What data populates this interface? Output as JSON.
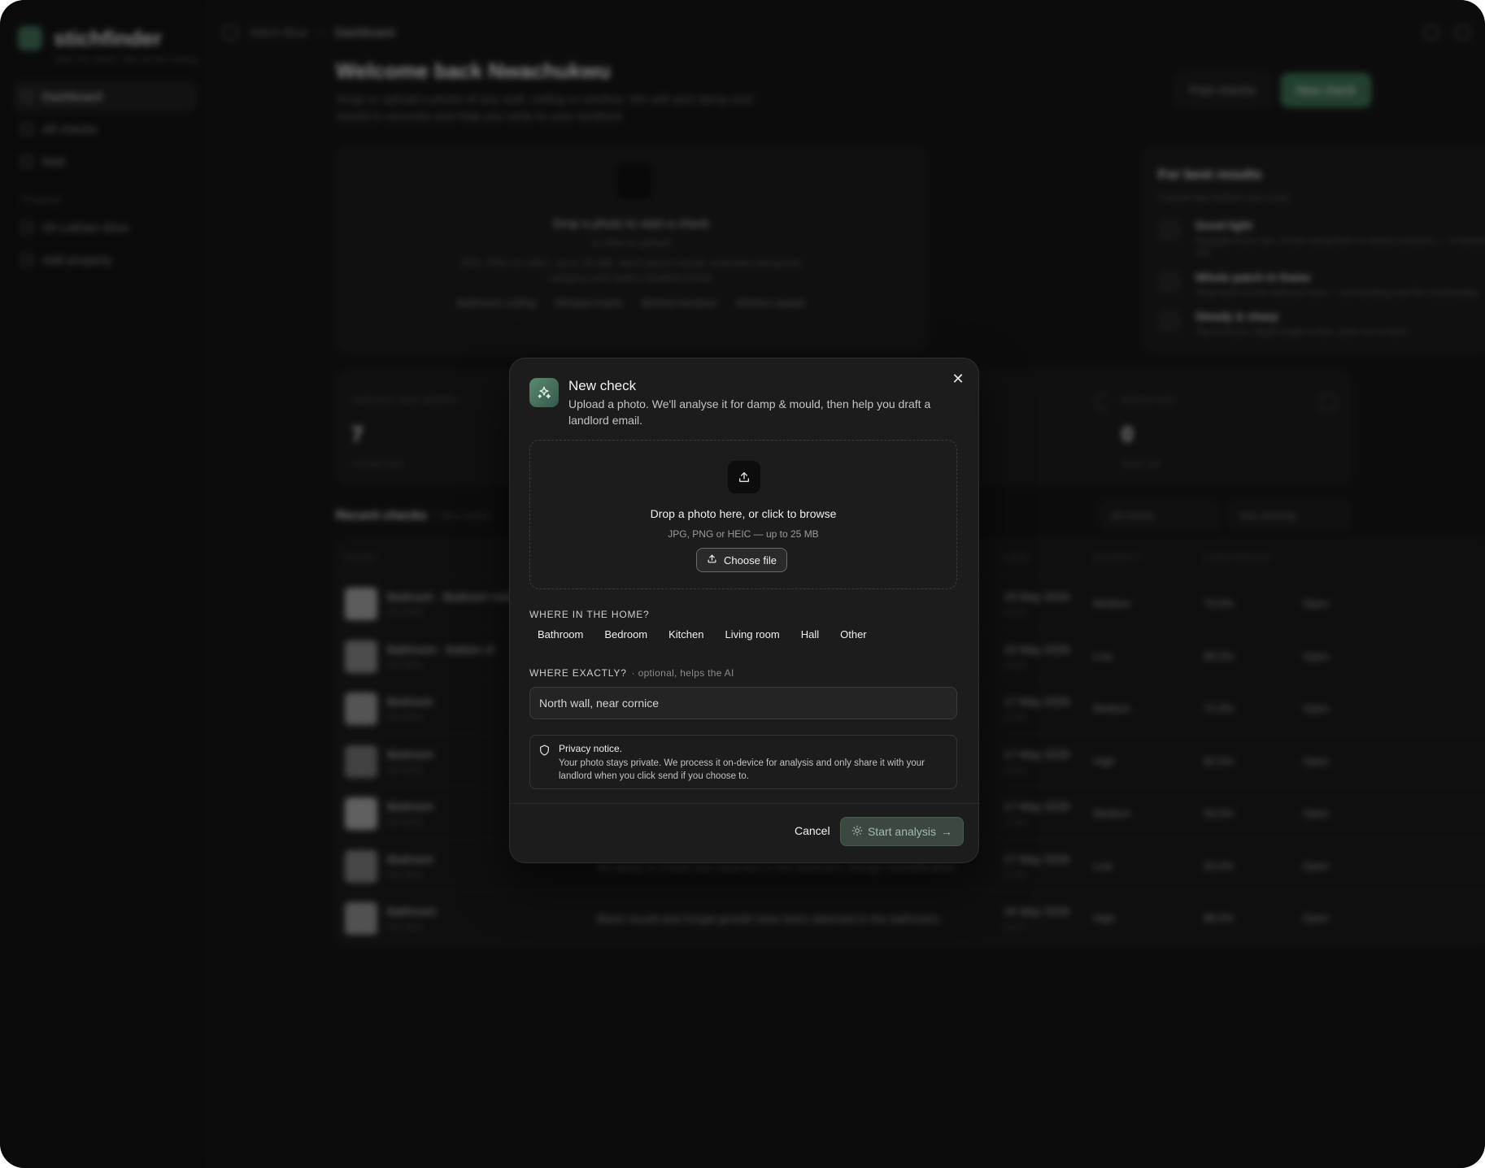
{
  "app": {
    "brand_name": "stichfinder",
    "brand_tagline": "Take the photo. We do the writing.",
    "nav": [
      {
        "label": "Dashboard",
        "active": true
      },
      {
        "label": "All checks",
        "active": false
      },
      {
        "label": "Mail",
        "active": false
      }
    ],
    "nav_section_label": "Property",
    "property_items": [
      {
        "label": "29 Lothian drive"
      },
      {
        "label": "Add property"
      }
    ]
  },
  "topbar": {
    "breadcrumb_root": "Stitch Blue",
    "breadcrumb_sep": "›",
    "breadcrumb_current": "Dashboard"
  },
  "header": {
    "welcome": "Welcome back Nwachukwu",
    "subtitle": "Snap or upload a photo of any wall, ceiling or window. We will spot damp and mould in seconds and help you write to your landlord.",
    "past_checks_label": "Past checks",
    "new_check_label": "New check"
  },
  "drop_card": {
    "title": "Drop a photo to start a check",
    "subtitle": "or click to upload",
    "desc": "JPG, PNG or HEIC, up to 25 MB. We'll detect mould, estimate dampness category and draft a landlord email.",
    "chips": [
      "Bathroom ceiling",
      "Window frame",
      "Behind furniture",
      "Kitchen splash"
    ]
  },
  "tips": {
    "title": "For best results",
    "subtitle": "3 quick tips before you snap",
    "items": [
      {
        "h": "Good light",
        "b": "Daylight if you can. Avoid using flash on damp surfaces — it washes them out."
      },
      {
        "h": "Whole patch in frame",
        "b": "Step back so the affected area + surrounding wall fits comfortably."
      },
      {
        "h": "Steady & sharp",
        "b": "Tap to focus. Slight angle is fine, steer on to level."
      }
    ]
  },
  "stats": [
    {
      "label": "CHECKS THIS MONTH",
      "value": "7",
      "sub": "+2 from last"
    },
    {
      "label": "RESOLVED",
      "value": "0",
      "sub": "None yet"
    }
  ],
  "recent": {
    "title": "Recent checks",
    "count": "7 this month",
    "filter_rooms": "All rooms",
    "filter_severity": "Any severity",
    "columns": [
      "ROOM",
      "DATE",
      "SEVERITY",
      "CONFIDENCE"
    ],
    "rows": [
      {
        "room": "Bedroom · Bedroom wall",
        "id": "SH-2480",
        "summary": "",
        "date": "18 May 2026",
        "time": "20:14",
        "sev": "Medium",
        "conf": "73.0%",
        "open": "Open"
      },
      {
        "room": "Bathroom · bottom of",
        "id": "SH-2481",
        "summary": "",
        "date": "18 May 2026",
        "time": "19:02",
        "sev": "Low",
        "conf": "88.0%",
        "open": "Open"
      },
      {
        "room": "Bedroom",
        "id": "SH-2452",
        "summary": "",
        "date": "17 May 2026",
        "time": "21:02",
        "sev": "Medium",
        "conf": "72.0%",
        "open": "Open"
      },
      {
        "room": "Bedroom",
        "id": "SH-2452",
        "summary": "",
        "date": "17 May 2026",
        "time": "18:02",
        "sev": "High",
        "conf": "82.0%",
        "open": "Open"
      },
      {
        "room": "Bedroom",
        "id": "SH-2451",
        "summary": "",
        "date": "17 May 2026",
        "time": "17:04",
        "sev": "Medium",
        "conf": "59.0%",
        "open": "Open"
      },
      {
        "room": "Bedroom",
        "id": "SH-2451",
        "summary": "No damp or mould was detected in this bedroom, though humidification",
        "date": "17 May 2026",
        "time": "17:06",
        "sev": "Low",
        "conf": "25.0%",
        "open": "Open"
      },
      {
        "room": "Bathroom",
        "id": "SH-2451",
        "summary": "Black mould and fungal growth have been detected in the bathroom,",
        "date": "16 May 2026",
        "time": "20:17",
        "sev": "High",
        "conf": "88.0%",
        "open": "Open"
      }
    ]
  },
  "modal": {
    "title": "New check",
    "description": "Upload a photo. We'll analyse it for damp & mould, then help you draft a landlord email.",
    "drop_title": "Drop a photo here, or click to browse",
    "drop_sub": "JPG, PNG or HEIC — up to 25 MB",
    "choose_file": "Choose file",
    "room_label": "WHERE IN THE HOME?",
    "rooms": [
      "Bathroom",
      "Bedroom",
      "Kitchen",
      "Living room",
      "Hall",
      "Other"
    ],
    "exact_label": "WHERE EXACTLY?",
    "exact_hint": "· optional, helps the AI",
    "exact_value": "North wall, near cornice",
    "privacy_title": "Privacy notice.",
    "privacy_body": "Your photo stays private. We process it on-device for analysis and only share it with your landlord when you click send if you choose to.",
    "cancel": "Cancel",
    "start": "Start analysis",
    "accent": "#5a8a70"
  }
}
